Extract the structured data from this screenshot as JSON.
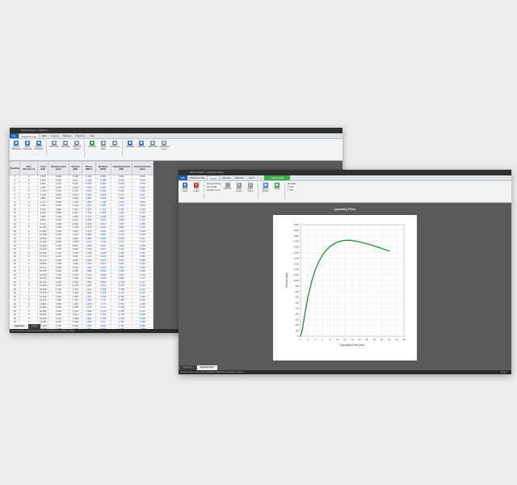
{
  "window1": {
    "title": "Ratio Analysis - [Sheet1] - ...",
    "menu": [
      "File",
      "Data/Formula",
      "Edit",
      "Layout",
      "Results",
      "Reports",
      "View"
    ],
    "menu_active_index": 1,
    "ribbon_buttons": [
      "Reload Workbook",
      "Reset Workbook",
      "Quantum Workbook",
      "Fast Copy",
      "New Data",
      "Select All Sheets",
      "Compute",
      "Series Table",
      "Add Series",
      "Quantities",
      "Statistics",
      "Store Data",
      "Load/Return Layout"
    ],
    "columns": [
      "Reading",
      "Time (hh:mm:ss)",
      "Load (kN)",
      "Displacement (mm)",
      "Tension (kN)",
      "Stress (MPa)",
      "Modulus (GPa)",
      "Calculated Flow (kN)",
      "Corrected Flow (mm)"
    ],
    "rows": [
      [
        "0",
        "0",
        "0.000",
        "0.000",
        "0.000",
        "0.000",
        "0.000",
        "0.000",
        "0.000"
      ],
      [
        "0",
        "0",
        "0.500",
        "0.040",
        "0.012",
        "0.140",
        "0.108",
        "0.108",
        "0.116"
      ],
      [
        "0",
        "0",
        "0.810",
        "0.120",
        "0.210",
        "0.250",
        "0.280",
        "0.346",
        "0.208"
      ],
      [
        "0",
        "0",
        "1.200",
        "0.200",
        "0.410",
        "0.350",
        "0.540",
        "0.520",
        "0.352"
      ],
      [
        "0",
        "0",
        "1.720",
        "0.310",
        "0.742",
        "0.410",
        "0.720",
        "0.641",
        "0.481"
      ],
      [
        "0",
        "0",
        "2.120",
        "0.420",
        "0.812",
        "0.463",
        "0.828",
        "0.727",
        "0.601"
      ],
      [
        "0",
        "0",
        "2.580",
        "0.560",
        "0.940",
        "0.550",
        "1.023",
        "0.808",
        "0.710"
      ],
      [
        "0",
        "0",
        "3.170",
        "0.690",
        "1.002",
        "0.580",
        "1.195",
        "0.874",
        "0.809"
      ],
      [
        "10",
        "0",
        "4.040",
        "0.800",
        "1.300",
        "0.610",
        "1.500",
        "1.043",
        "0.909"
      ],
      [
        "10",
        "0",
        "5.000",
        "0.890",
        "1.531",
        "0.670",
        "1.716",
        "1.153",
        "1.000"
      ],
      [
        "10",
        "0",
        "6.230",
        "0.980",
        "1.827",
        "0.700",
        "1.925",
        "1.264",
        "1.075"
      ],
      [
        "10",
        "0",
        "7.800",
        "1.100",
        "2.083",
        "0.747",
        "2.246",
        "1.420",
        "1.180"
      ],
      [
        "10",
        "0",
        "8.540",
        "1.200",
        "2.310",
        "0.805",
        "2.513",
        "1.560",
        "1.261"
      ],
      [
        "10",
        "0",
        "9.110",
        "1.300",
        "2.529",
        "0.840",
        "2.813",
        "1.697",
        "1.355"
      ],
      [
        "10",
        "0",
        "10.210",
        "1.400",
        "2.752",
        "0.870",
        "3.040",
        "1.823",
        "1.442"
      ],
      [
        "10",
        "0",
        "11.000",
        "1.500",
        "2.940",
        "0.915",
        "3.200",
        "1.930",
        "1.528"
      ],
      [
        "10",
        "0",
        "12.080",
        "1.600",
        "3.110",
        "0.950",
        "3.381",
        "2.014",
        "1.603"
      ],
      [
        "10",
        "0",
        "13.150",
        "1.700",
        "3.264",
        "0.980",
        "3.570",
        "2.094",
        "1.671"
      ],
      [
        "10",
        "0",
        "14.020",
        "1.800",
        "3.396",
        "1.010",
        "3.720",
        "2.174",
        "1.732"
      ],
      [
        "10",
        "0",
        "15.300",
        "1.900",
        "3.531",
        "1.055",
        "3.878",
        "2.261",
        "1.795"
      ],
      [
        "20",
        "0",
        "16.020",
        "2.000",
        "3.640",
        "1.092",
        "4.010",
        "2.331",
        "1.848"
      ],
      [
        "20",
        "0",
        "16.850",
        "2.100",
        "3.752",
        "1.140",
        "4.133",
        "2.396",
        "1.897"
      ],
      [
        "20",
        "0",
        "17.700",
        "2.200",
        "3.851",
        "1.174",
        "4.232",
        "2.452",
        "1.943"
      ],
      [
        "20",
        "0",
        "18.120",
        "2.300",
        "3.940",
        "1.203",
        "4.316",
        "2.503",
        "1.985"
      ],
      [
        "20",
        "0",
        "18.580",
        "2.400",
        "4.020",
        "1.230",
        "4.402",
        "2.551",
        "2.023"
      ],
      [
        "20",
        "0",
        "19.010",
        "2.500",
        "4.091",
        "1.260",
        "4.470",
        "2.594",
        "2.058"
      ],
      [
        "20",
        "0",
        "19.350",
        "2.600",
        "4.152",
        "1.285",
        "4.533",
        "2.630",
        "2.090"
      ],
      [
        "20",
        "0",
        "19.780",
        "2.700",
        "4.210",
        "1.310",
        "4.590",
        "2.663",
        "2.120"
      ],
      [
        "20",
        "0",
        "20.100",
        "2.800",
        "4.260",
        "1.336",
        "4.640",
        "2.692",
        "2.147"
      ],
      [
        "20",
        "0",
        "20.400",
        "2.900",
        "4.304",
        "1.360",
        "4.680",
        "2.718",
        "2.171"
      ],
      [
        "30",
        "0",
        "20.680",
        "3.000",
        "4.343",
        "1.382",
        "4.712",
        "2.740",
        "2.193"
      ],
      [
        "30",
        "0",
        "20.950",
        "3.100",
        "4.376",
        "1.401",
        "4.738",
        "2.758",
        "2.212"
      ],
      [
        "30",
        "0",
        "21.180",
        "3.200",
        "4.404",
        "1.420",
        "4.756",
        "2.772",
        "2.229"
      ],
      [
        "30",
        "0",
        "21.400",
        "3.300",
        "4.426",
        "1.437",
        "4.768",
        "2.782",
        "2.243"
      ],
      [
        "30",
        "0",
        "21.620",
        "3.400",
        "4.443",
        "1.452",
        "4.774",
        "2.788",
        "2.255"
      ],
      [
        "30",
        "0",
        "21.800",
        "3.500",
        "4.456",
        "1.466",
        "4.775",
        "2.790",
        "2.265"
      ],
      [
        "30",
        "0",
        "21.960",
        "3.600",
        "4.465",
        "1.478",
        "4.772",
        "2.789",
        "2.273"
      ],
      [
        "30",
        "0",
        "22.090",
        "3.700",
        "4.470",
        "1.488",
        "4.764",
        "2.785",
        "2.279"
      ],
      [
        "30",
        "0",
        "22.200",
        "3.800",
        "4.471",
        "1.496",
        "4.752",
        "2.778",
        "2.283"
      ],
      [
        "30",
        "0",
        "22.300",
        "3.900",
        "4.468",
        "1.502",
        "4.736",
        "2.768",
        "2.285"
      ],
      [
        "40",
        "0",
        "22.380",
        "4.000",
        "4.462",
        "1.506",
        "4.717",
        "2.756",
        "2.286"
      ],
      [
        "40",
        "0",
        "22.440",
        "4.100",
        "4.452",
        "1.509",
        "4.695",
        "2.742",
        "2.285"
      ],
      [
        "40",
        "0",
        "22.480",
        "4.200",
        "4.440",
        "1.510",
        "4.670",
        "2.726",
        "2.282"
      ]
    ],
    "sheet_tabs": [
      "Specimen",
      "Graph"
    ],
    "sheet_tab_active": 0,
    "status": "Sensor: Ready  Load:0.000 kN  MODE: FORWARD  Recording: enabled"
  },
  "window2": {
    "title": "Ratio Analysis - [Quantity Flow]",
    "menu": [
      "File",
      "Data/Formula",
      "Graph",
      "Results",
      "Reports",
      "View"
    ],
    "menu_active_index": 2,
    "accent_tab": "Graph Tools",
    "ribbon_buttons": [
      "Default Graph",
      "Clear Graph",
      "Zoom Fit",
      "Graph Setup",
      "Select Series",
      "Display Options",
      "Palette",
      "Export"
    ],
    "ribbon_list": [
      "Manual Scaling",
      "Auto Scale",
      "Smooth Curve"
    ],
    "ribbon_toggle": "Hi-Scaler",
    "ribbon_values": [
      "X: 100",
      "Y: 100"
    ],
    "chart_caption": "Quantity Flow",
    "sheet_tabs": [
      "Specimen",
      "Quantity Flow"
    ],
    "sheet_tab_active": 1,
    "status": "Sensor: Ready  Load:0.000 kN  MODE: FORWARD  Recording: enabled",
    "status_right": "Ready"
  },
  "chart_data": {
    "type": "line",
    "title": "",
    "xlabel": "Calculated Flow (mm)",
    "ylabel": "Tension (kN)",
    "xlim": [
      0,
      28
    ],
    "ylim": [
      0,
      2000
    ],
    "xticks": [
      0,
      2,
      4,
      6,
      8,
      10,
      12,
      14,
      16,
      18,
      20,
      22,
      24,
      26,
      28
    ],
    "yticks": [
      0,
      100,
      200,
      300,
      400,
      500,
      600,
      700,
      800,
      900,
      1000,
      1100,
      1200,
      1300,
      1400,
      1500,
      1600,
      1700,
      1800,
      1900,
      2000
    ],
    "grid": true,
    "series": [
      {
        "x": [
          0,
          0.5,
          1,
          1.5,
          2,
          3,
          4,
          5,
          6,
          7,
          8,
          9,
          10,
          11,
          12,
          13,
          14,
          15,
          16,
          17,
          18,
          19,
          20,
          21,
          22,
          23,
          24
        ],
        "values": [
          0,
          120,
          330,
          520,
          700,
          980,
          1190,
          1340,
          1460,
          1545,
          1610,
          1655,
          1690,
          1708,
          1718,
          1722,
          1718,
          1705,
          1690,
          1675,
          1658,
          1638,
          1620,
          1598,
          1575,
          1550,
          1530
        ],
        "color": "#2e8b3e"
      }
    ]
  },
  "colors": {
    "desktop": "#ececec",
    "window_bg": "#5a5a5a",
    "accent_green": "#3fa84f",
    "curve": "#2e8b3e"
  }
}
